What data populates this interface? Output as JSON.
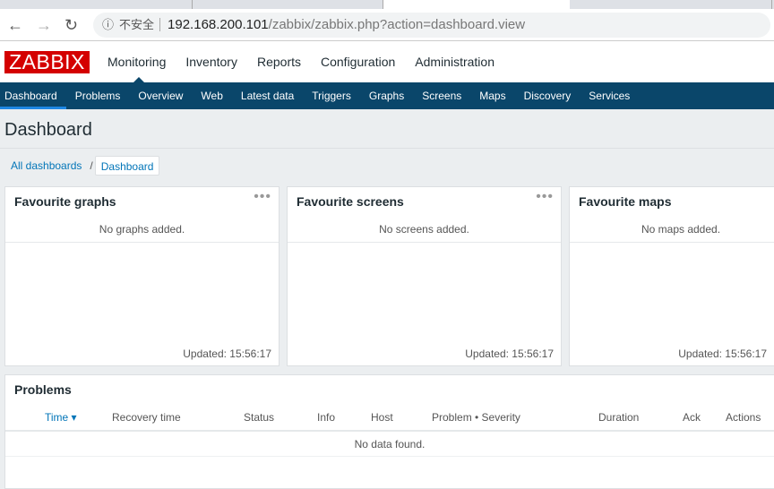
{
  "browser": {
    "url_host": "192.168.200.101",
    "url_path": "/zabbix/zabbix.php?action=dashboard.view",
    "security_label": "不安全"
  },
  "header": {
    "logo": "ZABBIX",
    "menu": [
      "Monitoring",
      "Inventory",
      "Reports",
      "Configuration",
      "Administration"
    ]
  },
  "submenu": [
    "Dashboard",
    "Problems",
    "Overview",
    "Web",
    "Latest data",
    "Triggers",
    "Graphs",
    "Screens",
    "Maps",
    "Discovery",
    "Services"
  ],
  "page": {
    "title": "Dashboard",
    "breadcrumb": [
      "All dashboards",
      "Dashboard"
    ]
  },
  "widgets": [
    {
      "title": "Favourite graphs",
      "empty": "No graphs added.",
      "updated": "Updated: 15:56:17"
    },
    {
      "title": "Favourite screens",
      "empty": "No screens added.",
      "updated": "Updated: 15:56:17"
    },
    {
      "title": "Favourite maps",
      "empty": "No maps added.",
      "updated": "Updated: 15:56:17"
    }
  ],
  "problems": {
    "title": "Problems",
    "columns": [
      "Time ▾",
      "Recovery time",
      "Status",
      "Info",
      "Host",
      "Problem • Severity",
      "Duration",
      "Ack",
      "Actions"
    ],
    "empty": "No data found."
  },
  "colors": {
    "brand": "#d40000",
    "nav": "#0a466a",
    "link": "#0275b8"
  }
}
